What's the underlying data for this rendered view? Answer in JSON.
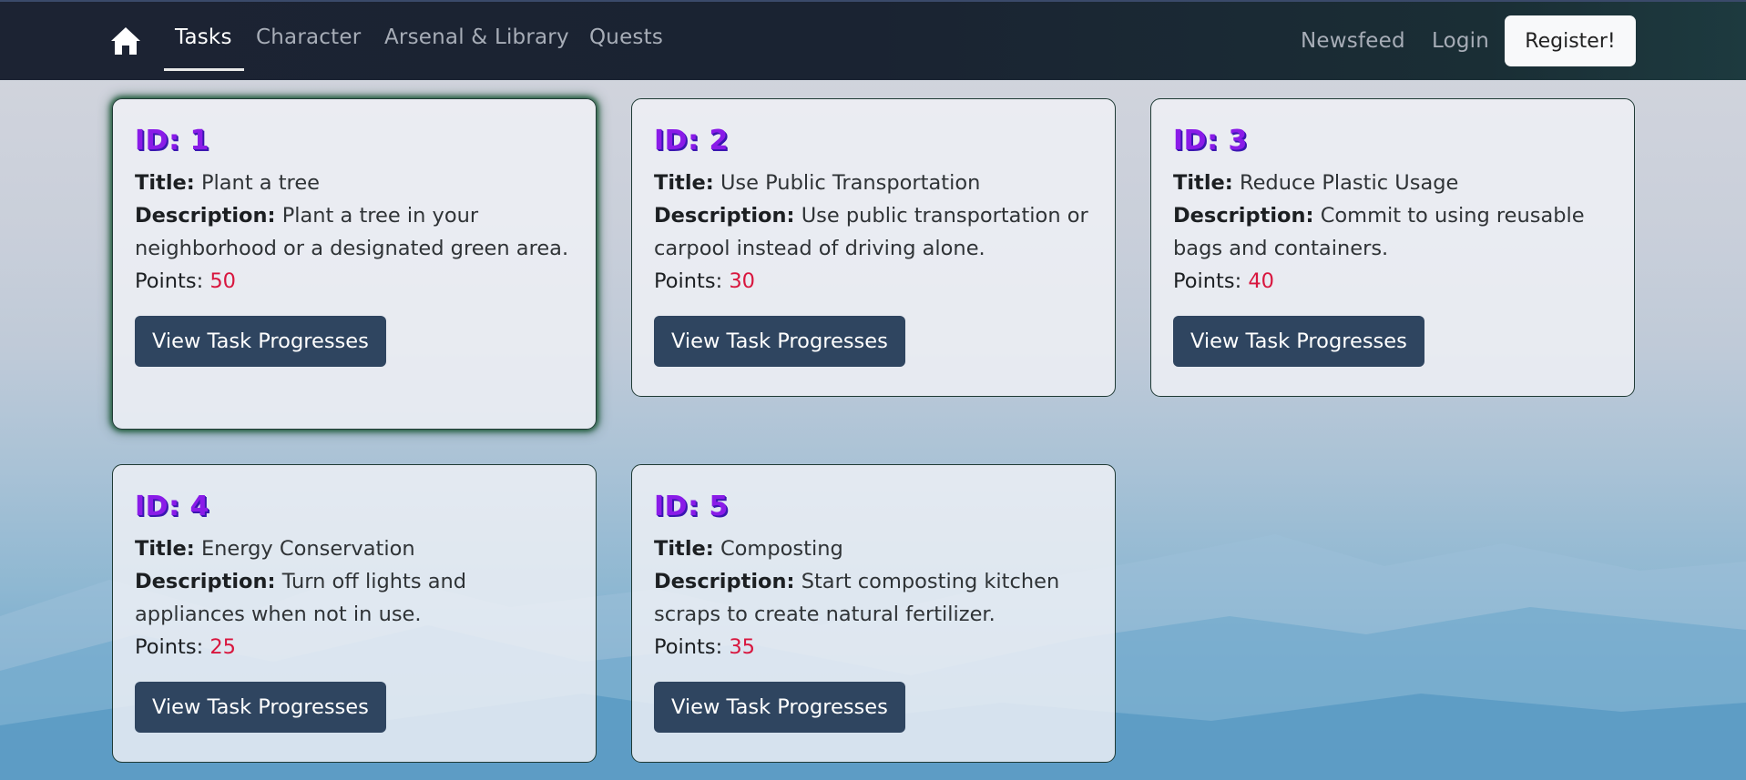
{
  "nav": {
    "home_icon": "home-icon",
    "links": [
      "Tasks",
      "Character",
      "Arsenal & Library",
      "Quests"
    ],
    "right_links": [
      "Newsfeed",
      "Login"
    ],
    "register_label": "Register!"
  },
  "tasks": [
    {
      "id_label": "ID: 1",
      "title_key": "Title:",
      "title": "Plant a tree",
      "desc_key": "Description:",
      "desc": "Plant a tree in your neighborhood or a designated green area.",
      "points_key": "Points:",
      "points": "50",
      "button": "View Task Progresses"
    },
    {
      "id_label": "ID: 2",
      "title_key": "Title:",
      "title": "Use Public Transportation",
      "desc_key": "Description:",
      "desc": "Use public transportation or carpool instead of driving alone.",
      "points_key": "Points:",
      "points": "30",
      "button": "View Task Progresses"
    },
    {
      "id_label": "ID: 3",
      "title_key": "Title:",
      "title": "Reduce Plastic Usage",
      "desc_key": "Description:",
      "desc": "Commit to using reusable bags and containers.",
      "points_key": "Points:",
      "points": "40",
      "button": "View Task Progresses"
    },
    {
      "id_label": "ID: 4",
      "title_key": "Title:",
      "title": "Energy Conservation",
      "desc_key": "Description:",
      "desc": "Turn off lights and appliances when not in use.",
      "points_key": "Points:",
      "points": "25",
      "button": "View Task Progresses"
    },
    {
      "id_label": "ID: 5",
      "title_key": "Title:",
      "title": "Composting",
      "desc_key": "Description:",
      "desc": "Start composting kitchen scraps to create natural fertilizer.",
      "points_key": "Points:",
      "points": "35",
      "button": "View Task Progresses"
    }
  ],
  "colors": {
    "id_purple": "#8a1be8",
    "points_red": "#d8163e",
    "button_bg": "#2f4560",
    "navbar_bg": "#1c2333"
  }
}
